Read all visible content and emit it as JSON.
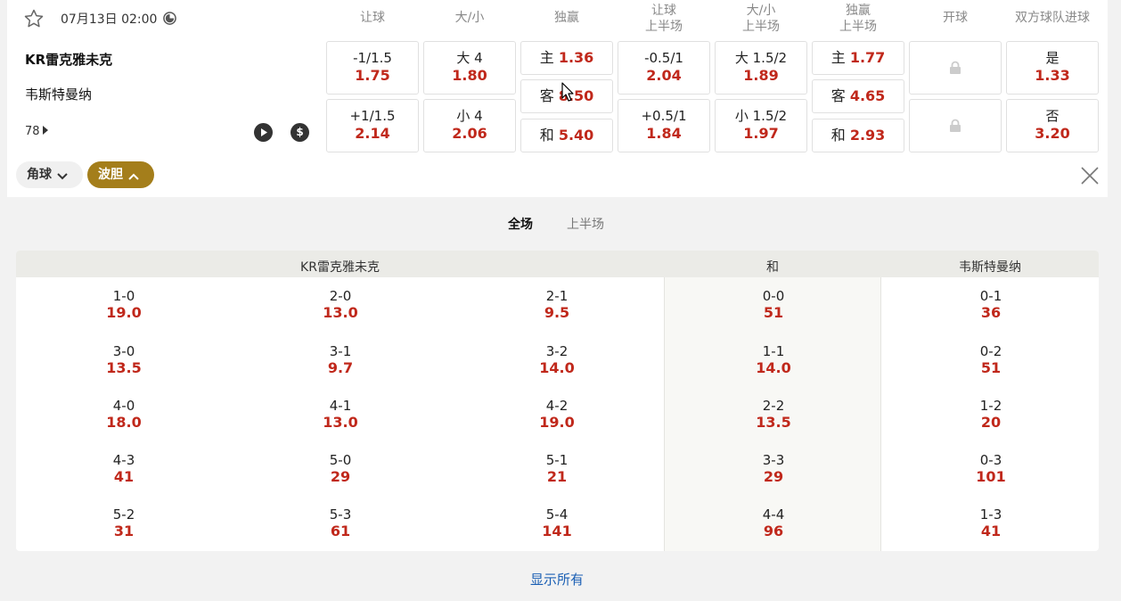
{
  "match": {
    "datetime": "07月13日 02:00",
    "home": "KR雷克雅未克",
    "away": "韦斯特曼纳",
    "more_count": "78"
  },
  "headers": [
    {
      "l1": "让球",
      "l2": ""
    },
    {
      "l1": "大/小",
      "l2": ""
    },
    {
      "l1": "独赢",
      "l2": ""
    },
    {
      "l1": "让球",
      "l2": "上半场"
    },
    {
      "l1": "大/小",
      "l2": "上半场"
    },
    {
      "l1": "独赢",
      "l2": "上半场"
    },
    {
      "l1": "开球",
      "l2": ""
    },
    {
      "l1": "双方球队进球",
      "l2": ""
    }
  ],
  "odds": {
    "handicap": [
      {
        "label": "-1/1.5",
        "odd": "1.75"
      },
      {
        "label": "+1/1.5",
        "odd": "2.14"
      }
    ],
    "total": [
      {
        "label": "大 4",
        "odd": "1.80"
      },
      {
        "label": "小 4",
        "odd": "2.06"
      }
    ],
    "winner": [
      {
        "label": "主",
        "odd": "1.36"
      },
      {
        "label": "客",
        "odd": "8.50"
      },
      {
        "label": "和",
        "odd": "5.40"
      }
    ],
    "handicap_1h": [
      {
        "label": "-0.5/1",
        "odd": "2.04"
      },
      {
        "label": "+0.5/1",
        "odd": "1.84"
      }
    ],
    "total_1h": [
      {
        "label": "大 1.5/2",
        "odd": "1.89"
      },
      {
        "label": "小 1.5/2",
        "odd": "1.97"
      }
    ],
    "winner_1h": [
      {
        "label": "主",
        "odd": "1.77"
      },
      {
        "label": "客",
        "odd": "4.65"
      },
      {
        "label": "和",
        "odd": "2.93"
      }
    ],
    "btts": [
      {
        "label": "是",
        "odd": "1.33"
      },
      {
        "label": "否",
        "odd": "3.20"
      }
    ]
  },
  "chips": {
    "corner": "角球",
    "correct_score": "波胆"
  },
  "subtabs": {
    "full": "全场",
    "first_half": "上半场"
  },
  "grid": {
    "home_header": "KR雷克雅未克",
    "draw_header": "和",
    "away_header": "韦斯特曼纳",
    "home_col1": [
      {
        "s": "1-0",
        "o": "19.0"
      },
      {
        "s": "3-0",
        "o": "13.5"
      },
      {
        "s": "4-0",
        "o": "18.0"
      },
      {
        "s": "4-3",
        "o": "41"
      },
      {
        "s": "5-2",
        "o": "31"
      }
    ],
    "home_col2": [
      {
        "s": "2-0",
        "o": "13.0"
      },
      {
        "s": "3-1",
        "o": "9.7"
      },
      {
        "s": "4-1",
        "o": "13.0"
      },
      {
        "s": "5-0",
        "o": "29"
      },
      {
        "s": "5-3",
        "o": "61"
      }
    ],
    "home_col3": [
      {
        "s": "2-1",
        "o": "9.5"
      },
      {
        "s": "3-2",
        "o": "14.0"
      },
      {
        "s": "4-2",
        "o": "19.0"
      },
      {
        "s": "5-1",
        "o": "21"
      },
      {
        "s": "5-4",
        "o": "141"
      }
    ],
    "draw": [
      {
        "s": "0-0",
        "o": "51"
      },
      {
        "s": "1-1",
        "o": "14.0"
      },
      {
        "s": "2-2",
        "o": "13.5"
      },
      {
        "s": "3-3",
        "o": "29"
      },
      {
        "s": "4-4",
        "o": "96"
      }
    ],
    "away": [
      {
        "s": "0-1",
        "o": "36"
      },
      {
        "s": "0-2",
        "o": "51"
      },
      {
        "s": "1-2",
        "o": "20"
      },
      {
        "s": "0-3",
        "o": "101"
      },
      {
        "s": "1-3",
        "o": "41"
      }
    ]
  },
  "show_all": "显示所有"
}
